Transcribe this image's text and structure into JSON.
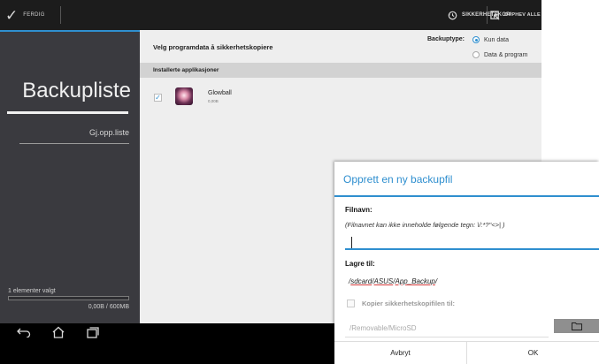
{
  "topbar": {
    "done_label": "FERDIG",
    "backup_label": "SIKKERHETSKOPI",
    "undo_all_label": "OPPHEV ALLE"
  },
  "sidebar": {
    "title": "Backupliste",
    "item": "Gj.opp.liste",
    "selected_count": "1 elementer valgt",
    "storage_text": "0,00B / 600MB",
    "storage_fraction": 0.0
  },
  "main": {
    "title": "Velg programdata å sikkerhetskopiere",
    "backup_type_label": "Backuptype:",
    "backup_type_options": [
      "Kun data",
      "Data & program"
    ],
    "backup_type_selected": "Kun data",
    "section_header": "Installerte applikasjoner",
    "apps": [
      {
        "name": "Glowball",
        "size": "0,00B",
        "checked": true,
        "icon": "glowball-app-icon"
      }
    ]
  },
  "dialog": {
    "title": "Opprett en ny backupfil",
    "filename_label": "Filnavn:",
    "filename_hint": "(Filnavnet kan ikke inneholde følgende tegn: \\/:*?\"<>| )",
    "filename_value": "",
    "save_to_label": "Lagre til:",
    "save_path_segments": [
      "sdcard",
      "ASUS",
      "App_Backup"
    ],
    "copy_label": "Kopier sikkerhetskopifilen til:",
    "copy_checked": false,
    "copy_location_placeholder": "/Removable/MicroSD",
    "cancel_label": "Avbryt",
    "ok_label": "OK"
  },
  "colors": {
    "accent": "#2f8fcf",
    "sidebar_bg": "#3a3a3f",
    "topbar_bg": "#1c1c1c"
  }
}
